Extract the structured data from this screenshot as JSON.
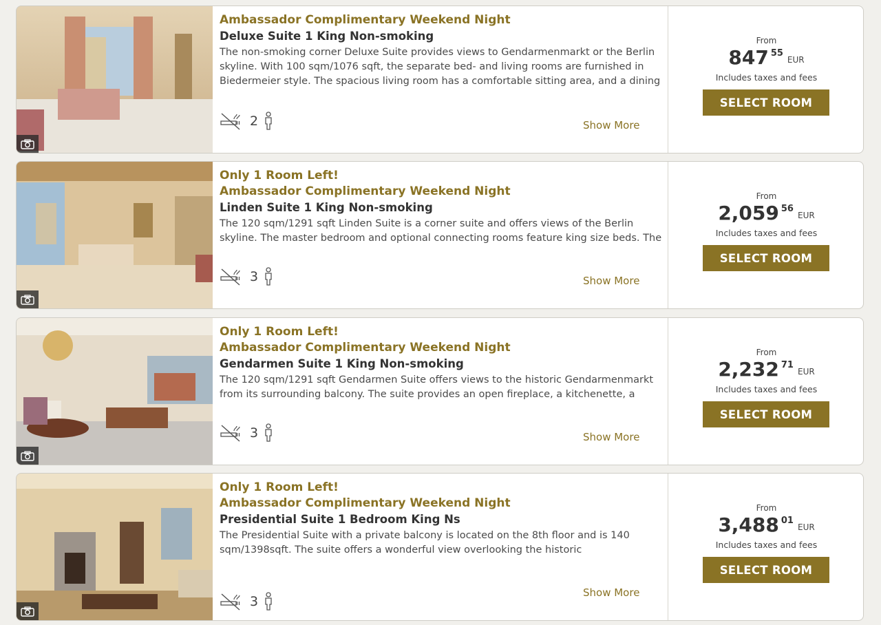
{
  "labels": {
    "from": "From",
    "taxes": "Includes taxes and fees",
    "select": "SELECT ROOM",
    "show_more": "Show More"
  },
  "rooms": [
    {
      "alert": "",
      "rate": "Ambassador Complimentary Weekend Night",
      "name": "Deluxe Suite 1 King Non-smoking",
      "desc": "The non-smoking corner Deluxe Suite provides views to Gendarmenmarkt or the Berlin skyline. With 100 sqm/1076 sqft, the separate bed- and living rooms are furnished in Biedermeier style. The spacious living room has a comfortable sitting area, and a dining",
      "occupancy": "2",
      "price_whole": "847",
      "price_cents": "55",
      "currency": "EUR"
    },
    {
      "alert": "Only 1 Room Left!",
      "rate": "Ambassador Complimentary Weekend Night",
      "name": "Linden Suite 1 King Non-smoking",
      "desc": "The 120 sqm/1291 sqft Linden Suite is a corner suite and offers views of the Berlin skyline. The master bedroom and optional connecting rooms feature king size beds. The suite",
      "occupancy": "3",
      "price_whole": "2,059",
      "price_cents": "56",
      "currency": "EUR"
    },
    {
      "alert": "Only 1 Room Left!",
      "rate": "Ambassador Complimentary Weekend Night",
      "name": "Gendarmen Suite 1 King Non-smoking",
      "desc": "The 120 sqm/1291 sqft Gendarmen Suite offers views to the historic Gendarmenmarkt from its surrounding balcony. The suite provides an open fireplace, a kitchenette, a dining table",
      "occupancy": "3",
      "price_whole": "2,232",
      "price_cents": "71",
      "currency": "EUR"
    },
    {
      "alert": "Only 1 Room Left!",
      "rate": "Ambassador Complimentary Weekend Night",
      "name": "Presidential Suite 1 Bedroom King Ns",
      "desc": "The Presidential Suite with a private balcony is located on the 8th floor and is 140 sqm/1398sqft. The suite offers a wonderful view overlooking the historic",
      "occupancy": "3",
      "price_whole": "3,488",
      "price_cents": "01",
      "currency": "EUR"
    }
  ],
  "colors": {
    "accent": "#8a7325",
    "background": "#f1f0ec"
  }
}
